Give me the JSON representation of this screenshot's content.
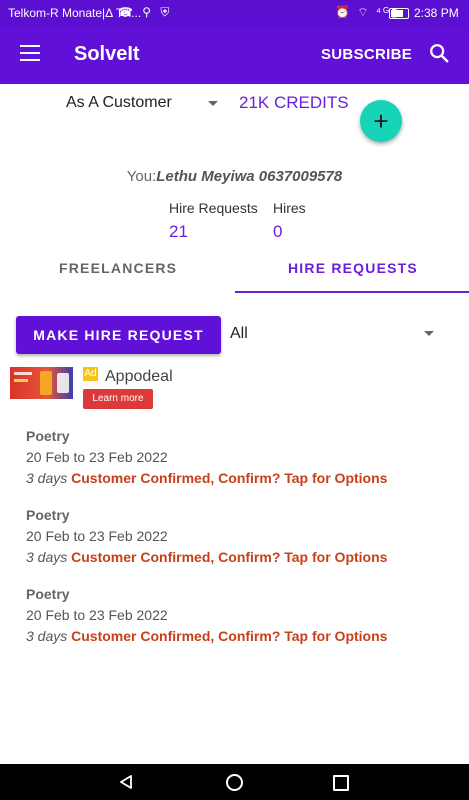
{
  "status_bar": {
    "carrier": "Telkom-R Monate|Δ Tel...",
    "left_icons": "☎ ⚲ ⛨",
    "right_icons": "⏰ ⌔ ⁴ᴳ▮",
    "time": "2:38 PM"
  },
  "app_bar": {
    "title": "SolveIt",
    "subscribe_label": "SUBSCRIBE",
    "menu_icon": "hamburger-menu-icon",
    "search_icon": "search-icon",
    "color": "#6110d8"
  },
  "account": {
    "role": "As A Customer",
    "credits": "21K CREDITS",
    "fab_symbol": "+",
    "you_prefix": "You:",
    "you_name": "Lethu Meyiwa 0637009578"
  },
  "stats": {
    "hire_requests_label": "Hire Requests",
    "hire_requests_value": "21",
    "hires_label": "Hires",
    "hires_value": "0"
  },
  "tabs": [
    {
      "label": "FREELANCERS",
      "active": false
    },
    {
      "label": "HIRE REQUESTS",
      "active": true
    }
  ],
  "actions": {
    "make_request_label": "MAKE HIRE REQUEST",
    "filter_value": "All"
  },
  "ad": {
    "badge": "Ad",
    "name": "Appodeal",
    "cta": "Learn more"
  },
  "requests": [
    {
      "title": "Poetry",
      "dates": "20 Feb to 23 Feb 2022",
      "duration": "3 days",
      "status": "Customer Confirmed, Confirm? Tap for Options"
    },
    {
      "title": "Poetry",
      "dates": "20 Feb to 23 Feb 2022",
      "duration": "3 days",
      "status": "Customer Confirmed, Confirm? Tap for Options"
    },
    {
      "title": "Poetry",
      "dates": "20 Feb to 23 Feb 2022",
      "duration": "3 days",
      "status": "Customer Confirmed, Confirm? Tap for Options"
    }
  ],
  "colors": {
    "primary": "#6110d8",
    "accent_text": "#6a1fd9",
    "fab": "#17d3b7",
    "status_text": "#c8401a"
  }
}
